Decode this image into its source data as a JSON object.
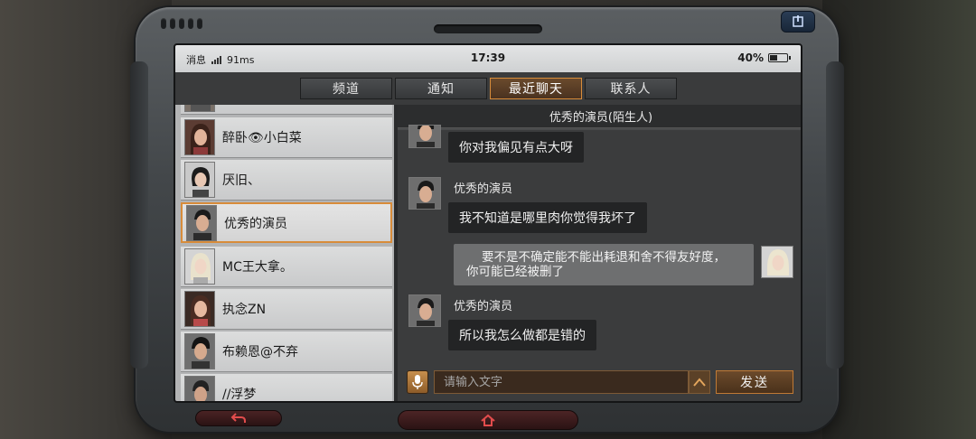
{
  "status": {
    "app_label": "消息",
    "ping": "91ms",
    "time": "17:39",
    "battery": "40%",
    "battery_level": 0.4
  },
  "tabs": [
    {
      "label": "频道",
      "active": false
    },
    {
      "label": "通知",
      "active": false
    },
    {
      "label": "最近聊天",
      "active": true
    },
    {
      "label": "联系人",
      "active": false
    }
  ],
  "contacts": [
    {
      "name": "醉卧👁小白菜",
      "avatar": "female-avatar",
      "active": false
    },
    {
      "name": "厌旧、",
      "avatar": "female-avatar",
      "active": false
    },
    {
      "name": "优秀的演员",
      "avatar": "male-avatar",
      "active": true
    },
    {
      "name": "MC王大拿。",
      "avatar": "female-avatar",
      "active": false
    },
    {
      "name": "执念ZN",
      "avatar": "female-avatar",
      "active": false
    },
    {
      "name": "布赖恩@不弃",
      "avatar": "male-avatar",
      "active": false
    },
    {
      "name": "//浮梦",
      "avatar": "male-avatar",
      "active": false
    }
  ],
  "chat": {
    "title": "优秀的演员(陌生人)",
    "messages": [
      {
        "sender": "",
        "text": "你对我偏见有点大呀",
        "mine": false
      },
      {
        "sender": "优秀的演员",
        "text": "我不知道是哪里肉你觉得我坏了",
        "mine": false
      },
      {
        "sender": "",
        "text_line1": "要不是不确定能不能出耗退和舍不得友好度，",
        "text_line2": "你可能已经被删了",
        "mine": true
      },
      {
        "sender": "优秀的演员",
        "text": "所以我怎么做都是错的",
        "mine": false
      }
    ],
    "input_placeholder": "请输入文字",
    "send_label": "发送"
  },
  "colors": {
    "accent": "#d88c3a",
    "back_button": "#4a2324",
    "top_button": "#2a3d55"
  },
  "icons": [
    "signal-icon",
    "battery-icon",
    "mic-icon",
    "expand-up-icon",
    "back-arrow-icon",
    "home-icon",
    "exit-icon"
  ]
}
